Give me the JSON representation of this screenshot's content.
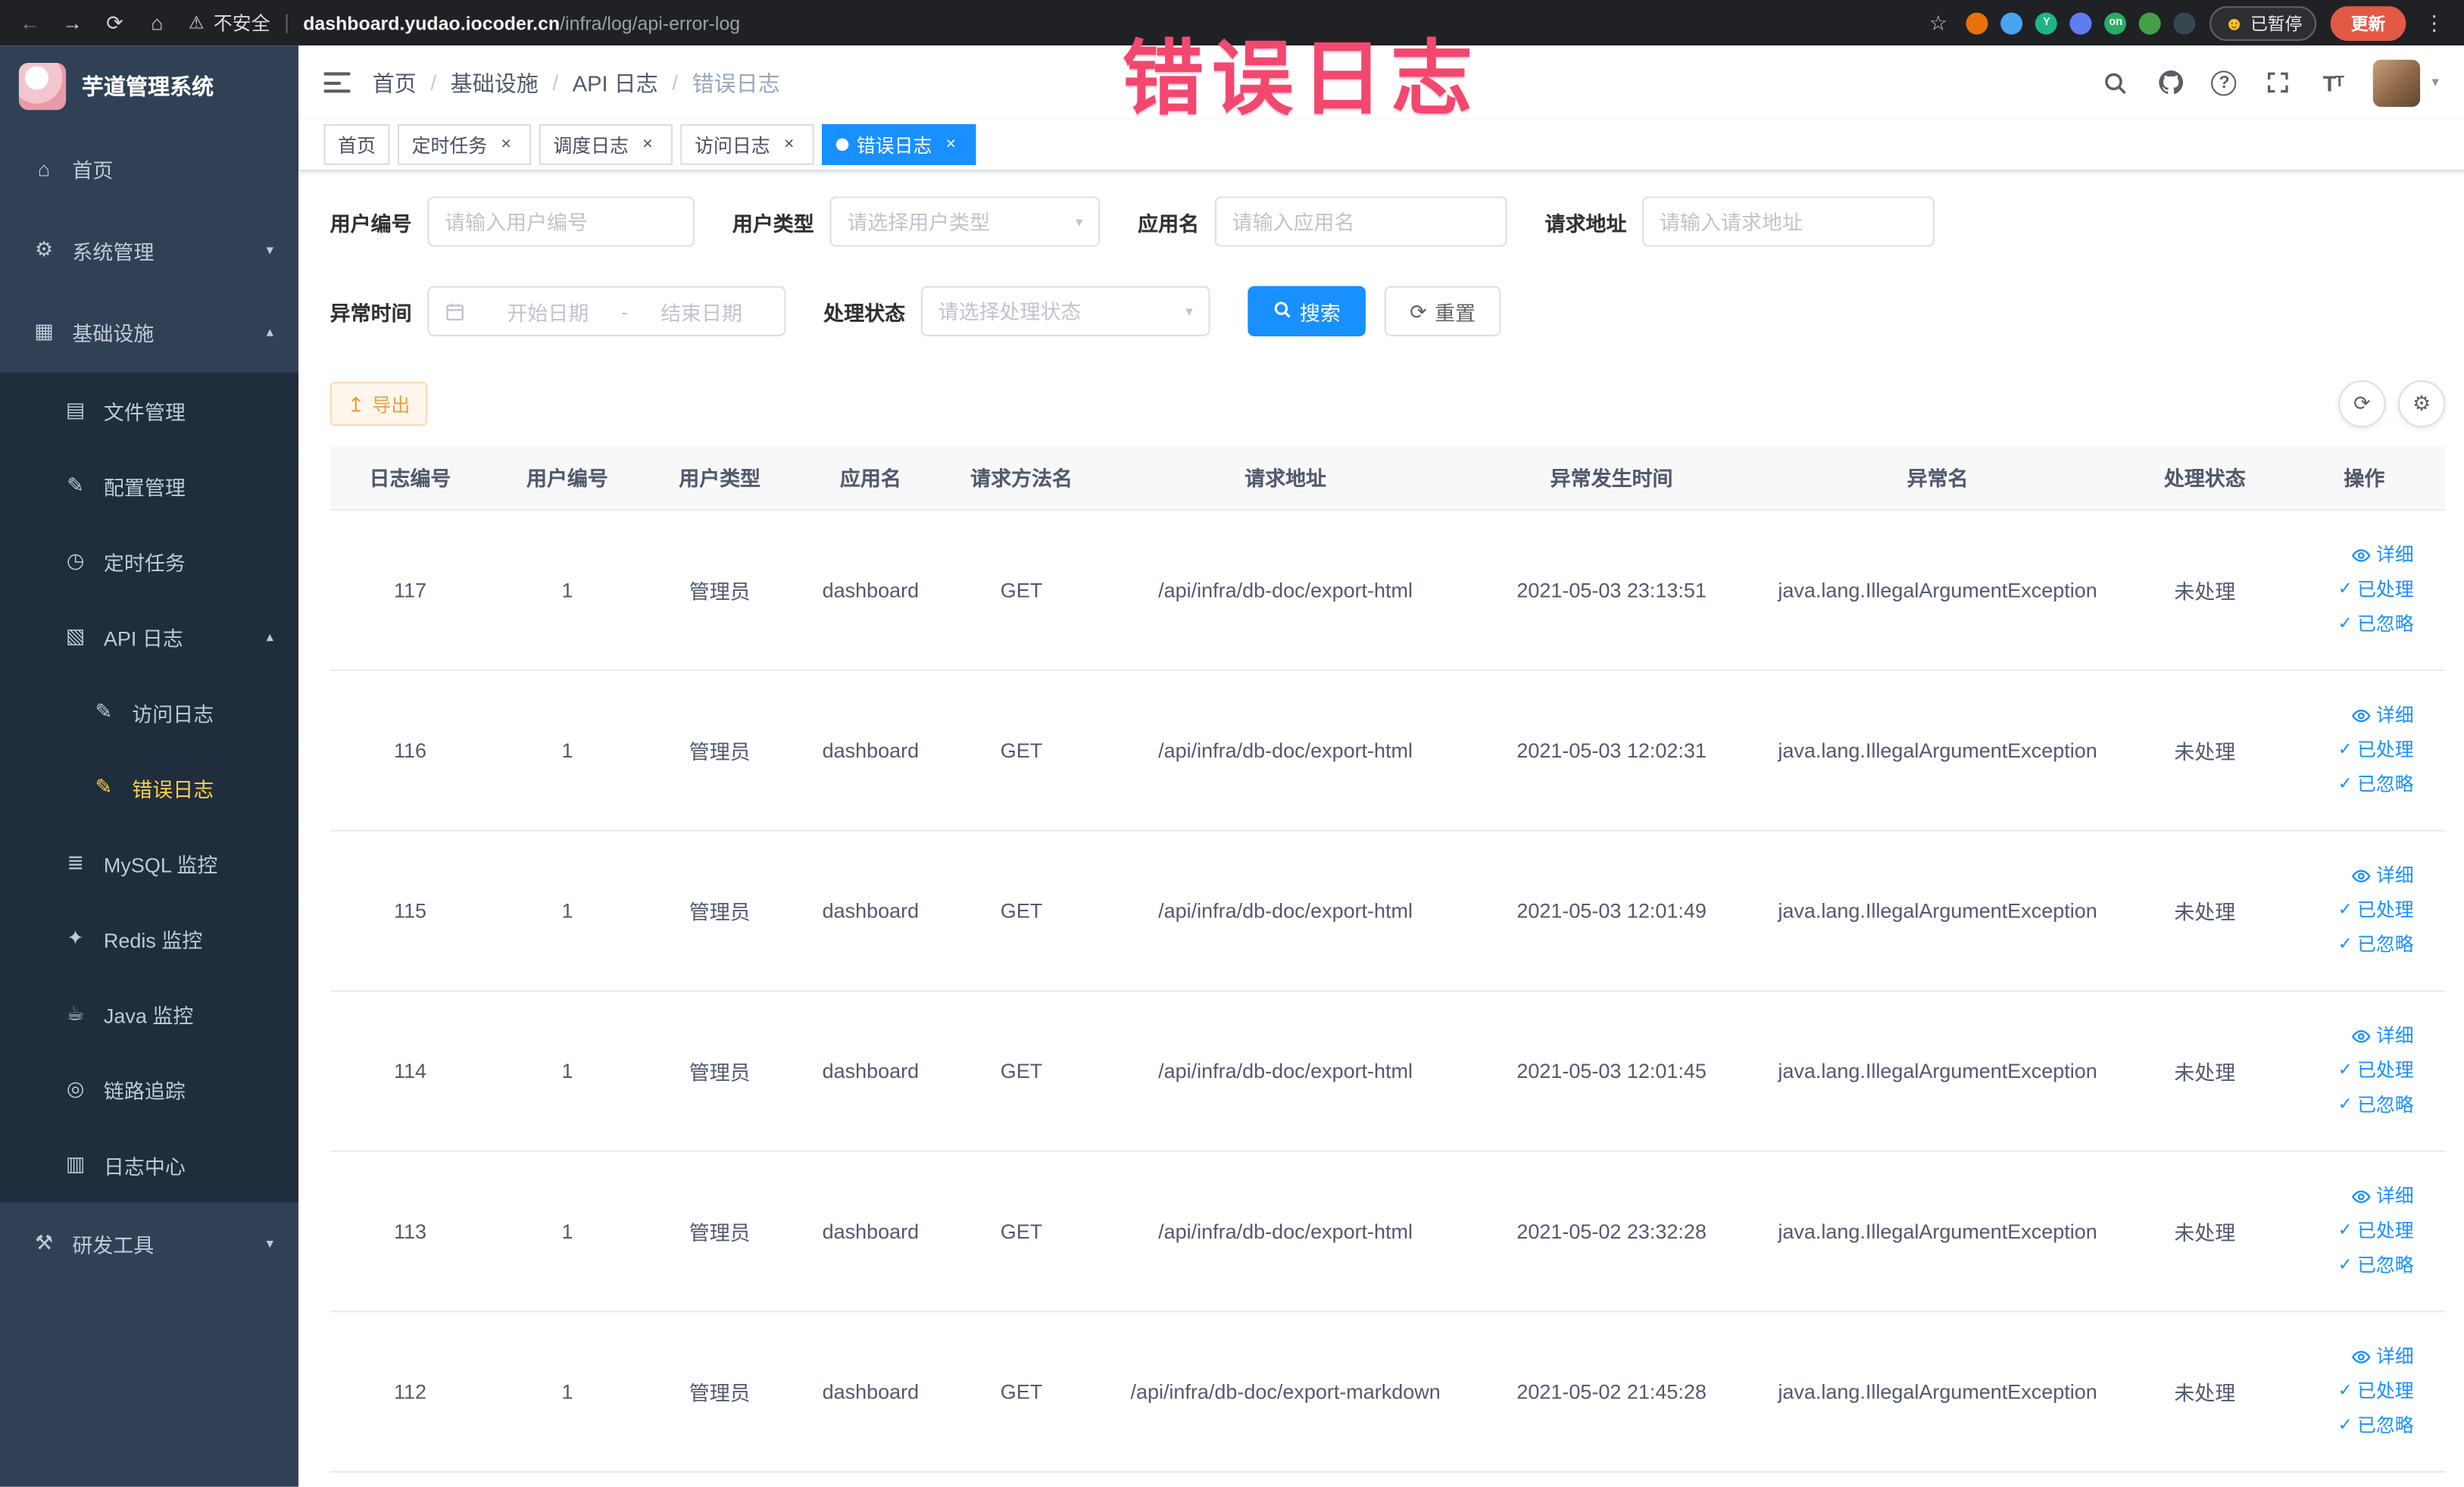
{
  "theme": {
    "primary": "#1890ff",
    "sidebar_bg": "#304156",
    "sidebar_sub_bg": "#1f2d3d",
    "sidebar_active": "#ffd04b",
    "warning": "#e6a23c",
    "warning_bg": "#fdf6ec",
    "warning_border": "#f5dab1",
    "annotation": "#f2486f"
  },
  "browser": {
    "security_label": "不安全",
    "url_domain": "dashboard.yudao.iocoder.cn",
    "url_path": "/infra/log/api-error-log",
    "paused_label": "已暂停",
    "update_label": "更新",
    "extensions": [
      {
        "name": "extension-1",
        "color": "#e8710a",
        "glyph": ""
      },
      {
        "name": "extension-2",
        "color": "#4aa3f0",
        "glyph": ""
      },
      {
        "name": "extension-3",
        "color": "#1db584",
        "glyph": "Y"
      },
      {
        "name": "extension-4",
        "color": "#5f7df2",
        "glyph": ""
      },
      {
        "name": "extension-5",
        "color": "#27ae60",
        "glyph": "on"
      },
      {
        "name": "extension-6",
        "color": "#43a047",
        "glyph": ""
      },
      {
        "name": "extension-7",
        "color": "#37474f",
        "glyph": ""
      }
    ]
  },
  "annotation": {
    "text": "错误日志"
  },
  "sidebar": {
    "logo_title": "芋道管理系统",
    "items": [
      {
        "key": "home",
        "label": "首页",
        "icon": "home-icon",
        "level": 1
      },
      {
        "key": "system",
        "label": "系统管理",
        "icon": "gear-icon",
        "level": 1,
        "arrow": "down"
      },
      {
        "key": "infra",
        "label": "基础设施",
        "icon": "infra-icon",
        "level": 1,
        "arrow": "up"
      },
      {
        "key": "file",
        "label": "文件管理",
        "icon": "file-icon",
        "level": 2
      },
      {
        "key": "config",
        "label": "配置管理",
        "icon": "config-icon",
        "level": 2
      },
      {
        "key": "job",
        "label": "定时任务",
        "icon": "timer-icon",
        "level": 2
      },
      {
        "key": "api-log",
        "label": "API 日志",
        "icon": "log-icon",
        "level": 2,
        "arrow": "up"
      },
      {
        "key": "access-log",
        "label": "访问日志",
        "icon": "doc-icon",
        "level": 3
      },
      {
        "key": "error-log",
        "label": "错误日志",
        "icon": "doc-icon",
        "level": 3,
        "active": true
      },
      {
        "key": "mysql",
        "label": "MySQL 监控",
        "icon": "database-icon",
        "level": 2
      },
      {
        "key": "redis",
        "label": "Redis 监控",
        "icon": "redis-icon",
        "level": 2
      },
      {
        "key": "java",
        "label": "Java 监控",
        "icon": "java-icon",
        "level": 2
      },
      {
        "key": "trace",
        "label": "链路追踪",
        "icon": "trace-icon",
        "level": 2
      },
      {
        "key": "log-center",
        "label": "日志中心",
        "icon": "log-center-icon",
        "level": 2
      },
      {
        "key": "devtools",
        "label": "研发工具",
        "icon": "tools-icon",
        "level": 1,
        "arrow": "down"
      }
    ]
  },
  "header": {
    "breadcrumb": [
      "首页",
      "基础设施",
      "API 日志",
      "错误日志"
    ]
  },
  "tabs": [
    {
      "label": "首页",
      "closable": false,
      "active": false
    },
    {
      "label": "定时任务",
      "closable": true,
      "active": false
    },
    {
      "label": "调度日志",
      "closable": true,
      "active": false
    },
    {
      "label": "访问日志",
      "closable": true,
      "active": false
    },
    {
      "label": "错误日志",
      "closable": true,
      "active": true
    }
  ],
  "filters": {
    "user_id": {
      "label": "用户编号",
      "placeholder": "请输入用户编号"
    },
    "user_type": {
      "label": "用户类型",
      "placeholder": "请选择用户类型"
    },
    "app_name": {
      "label": "应用名",
      "placeholder": "请输入应用名"
    },
    "request_url": {
      "label": "请求地址",
      "placeholder": "请输入请求地址"
    },
    "exception_time": {
      "label": "异常时间",
      "start_placeholder": "开始日期",
      "separator": "-",
      "end_placeholder": "结束日期"
    },
    "process_status": {
      "label": "处理状态",
      "placeholder": "请选择处理状态"
    },
    "search_label": "搜索",
    "reset_label": "重置"
  },
  "toolbar": {
    "export_label": "导出"
  },
  "table": {
    "columns": [
      "日志编号",
      "用户编号",
      "用户类型",
      "应用名",
      "请求方法名",
      "请求地址",
      "异常发生时间",
      "异常名",
      "处理状态",
      "操作"
    ],
    "actions": {
      "detail": "详细",
      "processed": "已处理",
      "ignored": "已忽略"
    },
    "rows": [
      {
        "id": "117",
        "user_id": "1",
        "user_type": "管理员",
        "app_name": "dashboard",
        "method": "GET",
        "url": "/api/infra/db-doc/export-html",
        "time": "2021-05-03 23:13:51",
        "exception": "java.lang.IllegalArgumentException",
        "status": "未处理"
      },
      {
        "id": "116",
        "user_id": "1",
        "user_type": "管理员",
        "app_name": "dashboard",
        "method": "GET",
        "url": "/api/infra/db-doc/export-html",
        "time": "2021-05-03 12:02:31",
        "exception": "java.lang.IllegalArgumentException",
        "status": "未处理"
      },
      {
        "id": "115",
        "user_id": "1",
        "user_type": "管理员",
        "app_name": "dashboard",
        "method": "GET",
        "url": "/api/infra/db-doc/export-html",
        "time": "2021-05-03 12:01:49",
        "exception": "java.lang.IllegalArgumentException",
        "status": "未处理"
      },
      {
        "id": "114",
        "user_id": "1",
        "user_type": "管理员",
        "app_name": "dashboard",
        "method": "GET",
        "url": "/api/infra/db-doc/export-html",
        "time": "2021-05-03 12:01:45",
        "exception": "java.lang.IllegalArgumentException",
        "status": "未处理"
      },
      {
        "id": "113",
        "user_id": "1",
        "user_type": "管理员",
        "app_name": "dashboard",
        "method": "GET",
        "url": "/api/infra/db-doc/export-html",
        "time": "2021-05-02 23:32:28",
        "exception": "java.lang.IllegalArgumentException",
        "status": "未处理"
      },
      {
        "id": "112",
        "user_id": "1",
        "user_type": "管理员",
        "app_name": "dashboard",
        "method": "GET",
        "url": "/api/infra/db-doc/export-markdown",
        "time": "2021-05-02 21:45:28",
        "exception": "java.lang.IllegalArgumentException",
        "status": "未处理"
      }
    ]
  }
}
